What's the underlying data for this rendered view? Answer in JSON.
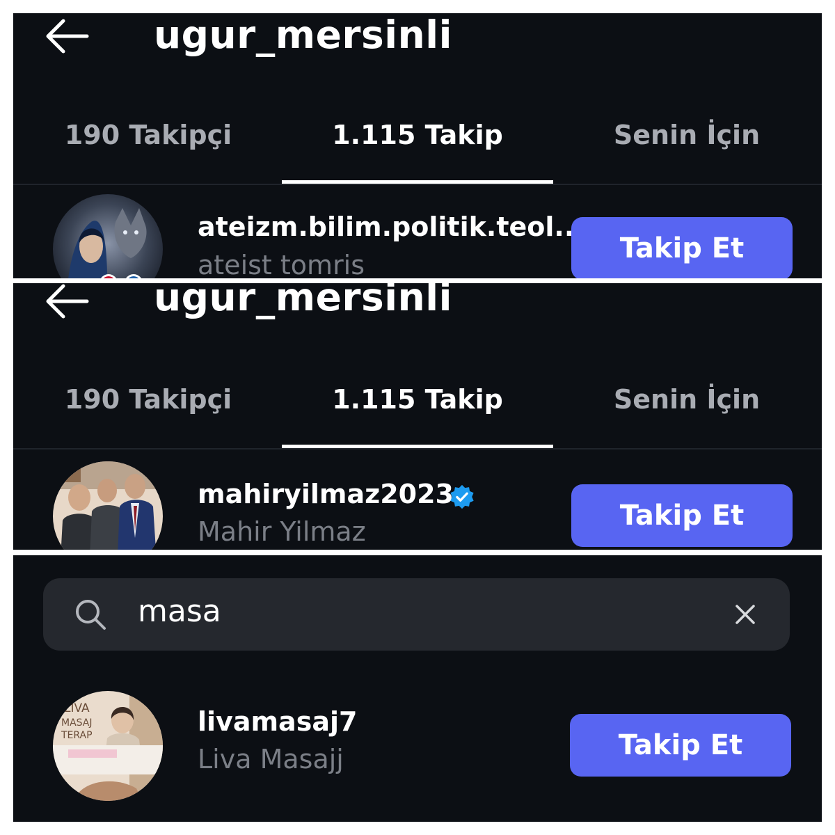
{
  "panels": [
    {
      "header": {
        "title": "ugur_mersinli"
      },
      "tabs": [
        {
          "label": "190 Takipçi"
        },
        {
          "label": "1.115 Takip"
        },
        {
          "label": "Senin İçin"
        }
      ],
      "active_tab": "1.115 Takip",
      "user": {
        "username": "ateizm.bilim.politik.teol...",
        "display_name": "ateist tomris",
        "verified": false,
        "follow_label": "Takip Et"
      }
    },
    {
      "header": {
        "title": "ugur_mersinli"
      },
      "tabs": [
        {
          "label": "190 Takipçi"
        },
        {
          "label": "1.115 Takip"
        },
        {
          "label": "Senin İçin"
        }
      ],
      "active_tab": "1.115 Takip",
      "user": {
        "username": "mahiryilmaz2023",
        "display_name": "Mahir Yilmaz",
        "verified": true,
        "follow_label": "Takip Et"
      }
    },
    {
      "search": {
        "value": "masa"
      },
      "user": {
        "username": "livamasaj7",
        "display_name": "Liva Masajj",
        "verified": false,
        "follow_label": "Takip Et",
        "avatar_text": [
          "LIVA",
          "MASAJ",
          "TERAP"
        ]
      }
    }
  ],
  "icons": {
    "back": "arrow-left-icon",
    "verified": "verified-badge-icon",
    "search": "search-icon",
    "clear": "close-icon"
  },
  "colors": {
    "background": "#0c0f14",
    "button": "#5865f2",
    "verified": "#1d9bf0",
    "text_muted": "#7b7f87",
    "tab_inactive": "#a9acb3"
  }
}
